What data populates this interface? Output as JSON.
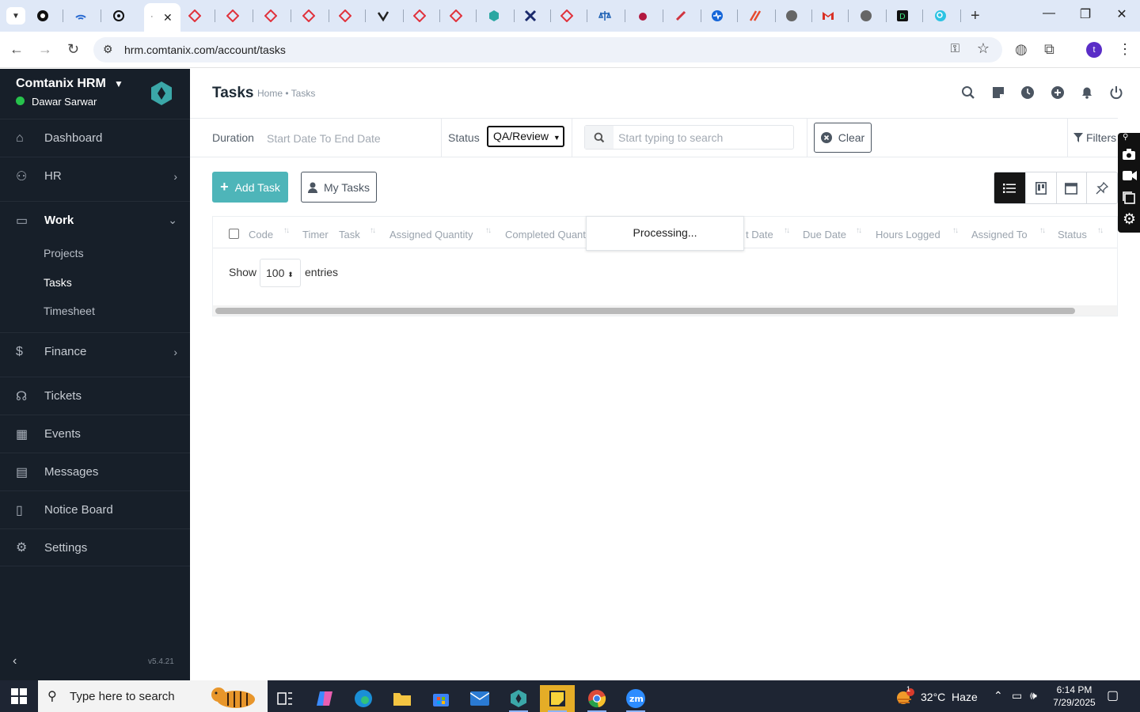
{
  "browser": {
    "url": "hrm.comtanix.com/account/tasks",
    "profile_initial": "t"
  },
  "sidebar": {
    "brand": "Comtanix HRM",
    "user": "Dawar Sarwar",
    "items": [
      {
        "label": "Dashboard",
        "icon": "home-icon"
      },
      {
        "label": "HR",
        "icon": "users-icon"
      },
      {
        "label": "Work",
        "icon": "briefcase-icon"
      },
      {
        "label": "Finance",
        "icon": "dollar-icon"
      },
      {
        "label": "Tickets",
        "icon": "headset-icon"
      },
      {
        "label": "Events",
        "icon": "calendar-icon"
      },
      {
        "label": "Messages",
        "icon": "message-icon"
      },
      {
        "label": "Notice Board",
        "icon": "clipboard-icon"
      },
      {
        "label": "Settings",
        "icon": "gear-icon"
      }
    ],
    "work_sub": [
      "Projects",
      "Tasks",
      "Timesheet"
    ],
    "version": "v5.4.21"
  },
  "header": {
    "title": "Tasks",
    "breadcrumb": "Home • Tasks"
  },
  "filters": {
    "duration_label": "Duration",
    "duration_placeholder": "Start Date To End Date",
    "status_label": "Status",
    "status_value": "QA/Review",
    "search_placeholder": "Start typing to search",
    "clear_label": "Clear",
    "filters_label": "Filters"
  },
  "actions": {
    "add_task": "Add Task",
    "my_tasks": "My Tasks"
  },
  "table": {
    "columns": [
      "Code",
      "Timer",
      "Task",
      "Assigned Quantity",
      "Completed Quant",
      "t Date",
      "Due Date",
      "Hours Logged",
      "Assigned To",
      "Status"
    ],
    "processing": "Processing...",
    "show_label": "Show",
    "entries_value": "100",
    "entries_label": "entries"
  },
  "taskbar": {
    "search_placeholder": "Type here to search",
    "weather": "32°C  Haze",
    "weather_badge": "1",
    "time": "6:14 PM",
    "date": "7/29/2025"
  },
  "colors": {
    "sidebar_bg": "#171f29",
    "accent": "#4eb5b9",
    "online": "#27c24c"
  }
}
